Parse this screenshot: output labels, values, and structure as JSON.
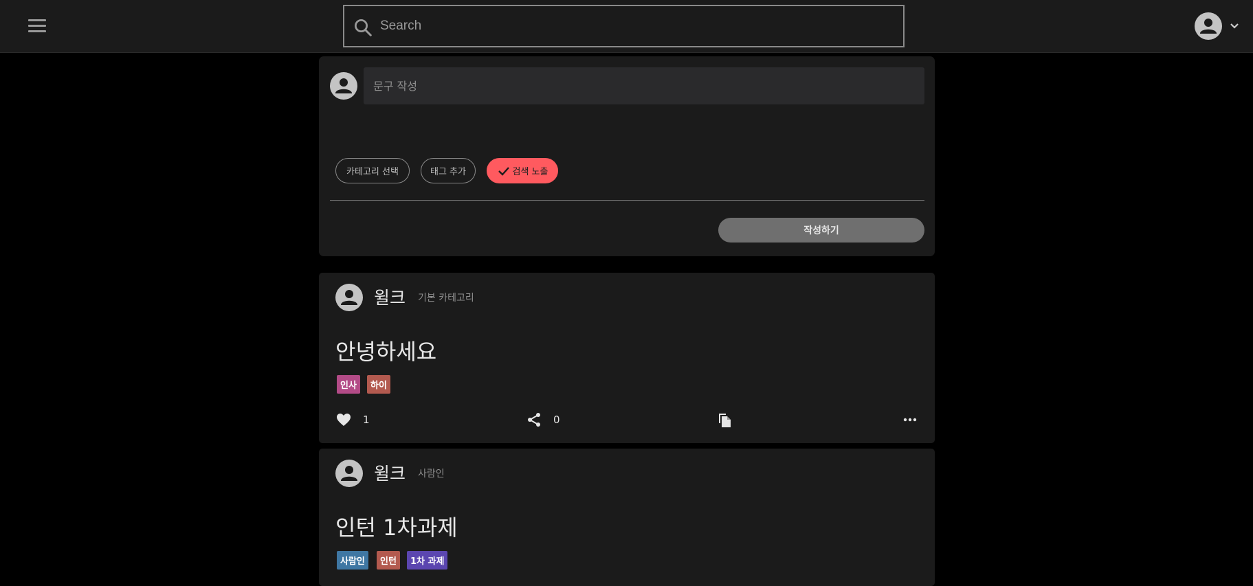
{
  "header": {
    "menu_icon": "hamburger-menu-icon",
    "search": {
      "placeholder": "Search",
      "value": "",
      "icon": "search-icon"
    },
    "account": {
      "icon": "account-circle-icon",
      "dropdown_icon": "chevron-down-icon"
    }
  },
  "composer": {
    "placeholder": "문구 작성",
    "chips": {
      "category": "카테고리 선택",
      "tag": "태그 추가",
      "search_exposure": "검색 노출"
    },
    "search_exposure_checked": true,
    "submit_label": "작성하기"
  },
  "posts": [
    {
      "author": "윌크",
      "category": "기본 카테고리",
      "title": "안녕하세요",
      "tags": [
        {
          "label": "인사",
          "color": "#b34b87"
        },
        {
          "label": "하이",
          "color": "#b35a4f"
        }
      ],
      "likes": "1",
      "shares": "0"
    },
    {
      "author": "윌크",
      "category": "사람인",
      "title": "인턴 1차과제",
      "tags": [
        {
          "label": "사람인",
          "color": "#3f77a3"
        },
        {
          "label": "인턴",
          "color": "#b35a4f"
        },
        {
          "label": "1차 과제",
          "color": "#5b46b0"
        }
      ]
    }
  ],
  "colors": {
    "accent": "#ff5a5f",
    "card_bg": "#1b1b1b",
    "page_bg": "#000000"
  }
}
